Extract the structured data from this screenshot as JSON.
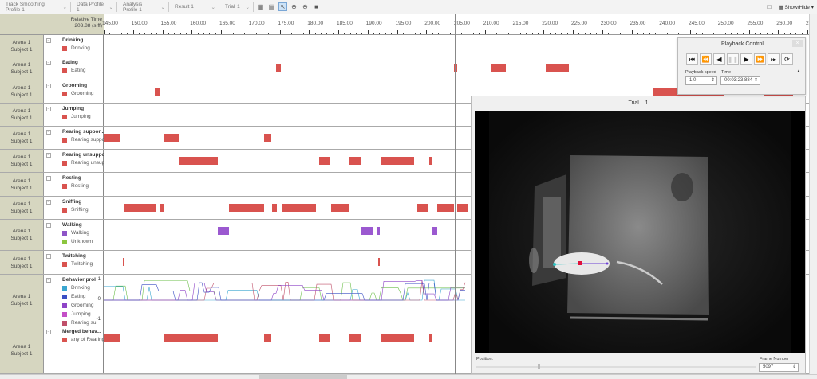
{
  "toolbar": {
    "dropdowns": [
      {
        "label": "Track Smoothing Profile 1"
      },
      {
        "label": "Data Profile 1"
      },
      {
        "label": "Analysis Profile 1"
      },
      {
        "label": "Result 1"
      }
    ],
    "trial_label": "Trial",
    "trial_value": "1",
    "show_hide_label": "Show/Hide"
  },
  "timeline": {
    "header_label": "Relative Time",
    "header_value": "203.88 (s.ff)",
    "start": 145,
    "end": 265,
    "tick_step": 5,
    "cursor_time": 204.9,
    "bar_color": "#d9534f"
  },
  "rows": [
    {
      "arena": "Arena 1",
      "subject": "Subject 1",
      "title": "Drinking",
      "items": [
        {
          "label": "Drinking",
          "color": "#d9534f"
        }
      ],
      "bars": []
    },
    {
      "arena": "Arena 1",
      "subject": "Subject 1",
      "title": "Eating",
      "items": [
        {
          "label": "Eating",
          "color": "#d9534f"
        }
      ],
      "bars": [
        [
          174.4,
          175.2
        ],
        [
          204.7,
          205.3
        ],
        [
          211.1,
          213.6
        ],
        [
          220.4,
          224.3
        ]
      ]
    },
    {
      "arena": "Arena 1",
      "subject": "Subject 1",
      "title": "Grooming",
      "items": [
        {
          "label": "Grooming",
          "color": "#d9534f"
        }
      ],
      "bars": [
        [
          153.7,
          154.5
        ],
        [
          238.6,
          250.7
        ],
        [
          257.5,
          262.5
        ]
      ]
    },
    {
      "arena": "Arena 1",
      "subject": "Subject 1",
      "title": "Jumping",
      "items": [
        {
          "label": "Jumping",
          "color": "#d9534f"
        }
      ],
      "bars": []
    },
    {
      "arena": "Arena 1",
      "subject": "Subject 1",
      "title": "Rearing suppor...",
      "items": [
        {
          "label": "Rearing suppor",
          "color": "#d9534f"
        }
      ],
      "bars": [
        [
          145,
          147.9
        ],
        [
          155.2,
          157.8
        ],
        [
          172.3,
          173.6
        ]
      ]
    },
    {
      "arena": "Arena 1",
      "subject": "Subject 1",
      "title": "Rearing unsuppor",
      "items": [
        {
          "label": "Rearing unsupp",
          "color": "#d9534f"
        }
      ],
      "bars": [
        [
          157.8,
          164.5
        ],
        [
          181.7,
          183.6
        ],
        [
          186.9,
          188.9
        ],
        [
          192.2,
          197.9
        ],
        [
          200.5,
          201.1
        ]
      ]
    },
    {
      "arena": "Arena 1",
      "subject": "Subject 1",
      "title": "Resting",
      "items": [
        {
          "label": "Resting",
          "color": "#d9534f"
        }
      ],
      "bars": []
    },
    {
      "arena": "Arena 1",
      "subject": "Subject 1",
      "title": "Sniffing",
      "items": [
        {
          "label": "Sniffing",
          "color": "#d9534f"
        }
      ],
      "bars": [
        [
          148.4,
          153.8
        ],
        [
          154.7,
          155.3
        ],
        [
          166.4,
          172.3
        ],
        [
          173.7,
          174.5
        ],
        [
          175.3,
          181.2
        ],
        [
          183.8,
          186.9
        ],
        [
          198.5,
          200.4
        ],
        [
          201.9,
          204.7
        ],
        [
          205.3,
          207.2
        ]
      ]
    },
    {
      "arena": "Arena 1",
      "subject": "Subject 1",
      "title": "Walking",
      "items": [
        {
          "label": "Walking",
          "color": "#8e55c7"
        },
        {
          "label": "Unknown",
          "color": "#8cc63f"
        }
      ],
      "bars": [
        [
          164.5,
          166.4
        ],
        [
          188.9,
          190.8
        ],
        [
          191.7,
          192.1
        ],
        [
          201.1,
          201.9
        ]
      ],
      "bar_color": "#9b59d0"
    },
    {
      "arena": "Arena 1",
      "subject": "Subject 1",
      "title": "Twitching",
      "items": [
        {
          "label": "Twitching",
          "color": "#d9534f"
        }
      ],
      "bars": [
        [
          148.3,
          148.5
        ],
        [
          191.8,
          192.1
        ]
      ]
    },
    {
      "arena": "Arena 1",
      "subject": "Subject 1",
      "title": "Behavior prol",
      "items": [
        {
          "label": "Drinking",
          "color": "#3aa6d0"
        },
        {
          "label": "Eating",
          "color": "#3b4fc4"
        },
        {
          "label": "Grooming",
          "color": "#8e44c7"
        },
        {
          "label": "Jumping",
          "color": "#c44fc7"
        },
        {
          "label": "Rearing su",
          "color": "#c0506a"
        }
      ],
      "axis": [
        "1",
        "0",
        "-1"
      ],
      "bars": []
    },
    {
      "arena": "Arena 1",
      "subject": "Subject 1",
      "title": "Merged behav...",
      "items": [
        {
          "label": "any of Rearing",
          "color": "#d9534f"
        }
      ],
      "bars": [
        [
          145,
          147.9
        ],
        [
          155.2,
          164.5
        ],
        [
          172.3,
          173.6
        ],
        [
          181.7,
          183.6
        ],
        [
          186.9,
          188.9
        ],
        [
          192.2,
          197.9
        ],
        [
          200.5,
          201.1
        ]
      ]
    }
  ],
  "playback": {
    "title": "Playback Control",
    "speed_label": "Playback speed",
    "speed_value": "1.0",
    "time_label": "Time",
    "time_value": "00:03:23.884"
  },
  "video": {
    "title": "Trial",
    "trial_number": "1",
    "position_label": "Position:",
    "position_fraction": 0.22,
    "frame_label": "Frame Number",
    "frame_value": "5097"
  }
}
